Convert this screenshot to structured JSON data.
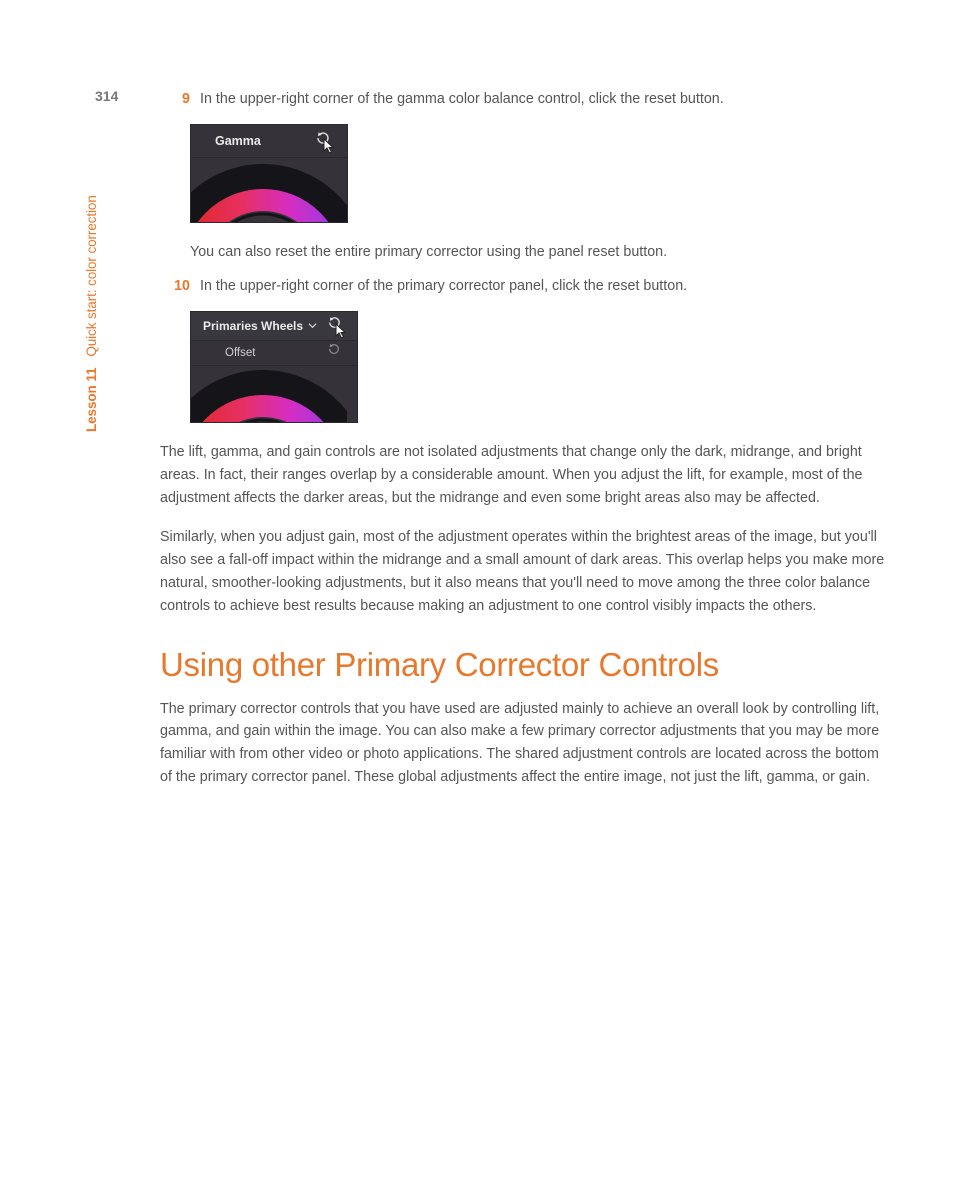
{
  "page_number": "314",
  "sidebar": {
    "lesson": "Lesson 11",
    "title": "Quick start: color correction"
  },
  "steps": [
    {
      "num": "9",
      "text": "In the upper-right corner of the gamma color balance control, click the reset button."
    },
    {
      "num": "10",
      "text": "In the upper-right corner of the primary corrector panel, click the reset button."
    }
  ],
  "fig1": {
    "label": "Gamma"
  },
  "fig2": {
    "label": "Primaries Wheels",
    "sublabel": "Offset"
  },
  "after_fig1": "You can also reset the entire primary corrector using the panel reset button.",
  "body": [
    "The lift, gamma, and gain controls are not isolated adjustments that change only the dark, midrange, and bright areas. In fact, their ranges overlap by a considerable amount. When you adjust the lift, for example, most of the adjustment affects the darker areas, but the midrange and even some bright areas also may be affected.",
    "Similarly, when you adjust gain, most of the adjustment operates within the brightest areas of the image, but you'll also see a fall-off impact within the midrange and a small amount of dark areas. This overlap helps you make more natural, smoother-looking adjustments, but it also means that you'll need to move among the three color balance controls to achieve best results because making an adjustment to one control visibly impacts the  others."
  ],
  "section_heading": "Using other Primary Corrector Controls",
  "section_body": "The primary corrector controls that you have used are adjusted mainly to achieve an overall look by controlling lift, gamma, and gain within the image. You can also make a few primary corrector adjustments that you may be more familiar with from other video or photo applications. The shared adjustment controls are located across the bottom of the primary corrector panel. These global adjustments affect the entire image, not just the lift, gamma, or gain."
}
